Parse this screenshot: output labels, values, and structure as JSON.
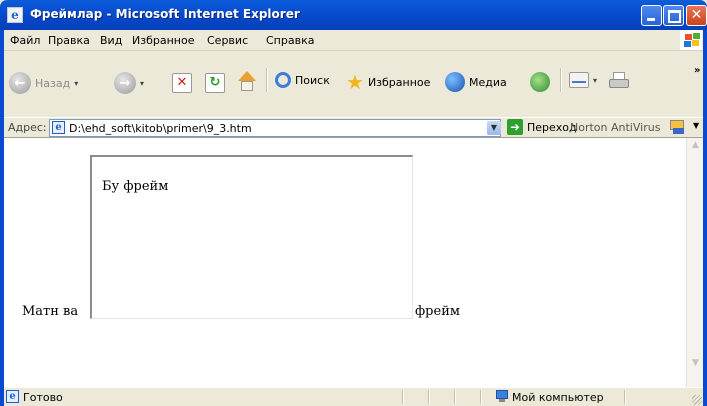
{
  "window": {
    "title": "Фреймлар - Microsoft Internet Explorer"
  },
  "menu": {
    "items": [
      "Файл",
      "Правка",
      "Вид",
      "Избранное",
      "Сервис",
      "Справка"
    ]
  },
  "toolbar": {
    "back_label": "Назад",
    "search_label": "Поиск",
    "favorites_label": "Избранное",
    "media_label": "Медиа"
  },
  "addressbar": {
    "label": "Адрес:",
    "url": "D:\\ehd_soft\\kitob\\primer\\9_3.htm",
    "go_label": "Переход",
    "plugin_label": "Norton AntiVirus"
  },
  "page": {
    "text_before": "Матн ва",
    "iframe_text": "Бу фрейм",
    "text_after": "фрейм"
  },
  "status": {
    "text": "Готово",
    "zone": "Мой компьютер"
  },
  "colors": {
    "titlebar": "#0647c9",
    "close_button": "#c9431b",
    "chrome": "#ece9d8"
  }
}
